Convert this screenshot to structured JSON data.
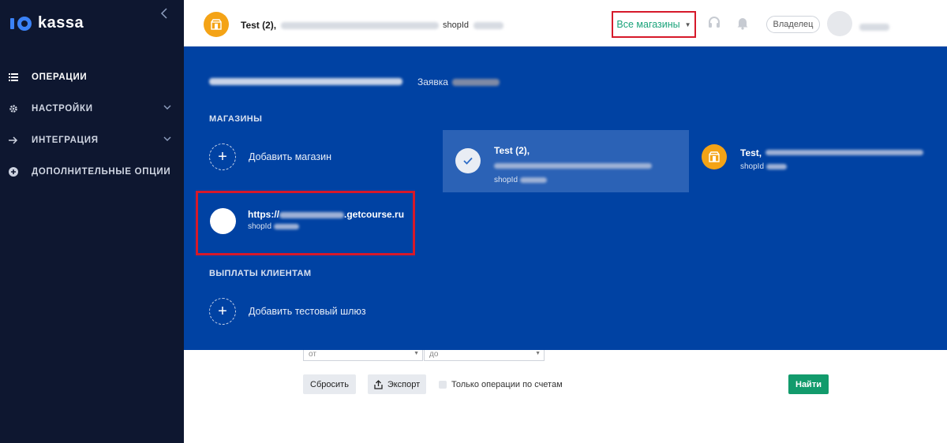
{
  "sidebar": {
    "logo_text": "kassa",
    "items": [
      {
        "label": "ОПЕРАЦИИ",
        "icon": "list-icon",
        "active": true,
        "has_chevron": false
      },
      {
        "label": "НАСТРОЙКИ",
        "icon": "gear-icon",
        "active": false,
        "has_chevron": true
      },
      {
        "label": "ИНТЕГРАЦИЯ",
        "icon": "arrow-right-icon",
        "active": false,
        "has_chevron": true
      },
      {
        "label": "ДОПОЛНИТЕЛЬНЫЕ ОПЦИИ",
        "icon": "plus-circle-icon",
        "active": false,
        "has_chevron": false
      }
    ]
  },
  "header": {
    "shop_name": "Test (2),",
    "shopid_label": "shopId",
    "all_shops_label": "Все магазины",
    "owner_label": "Владелец"
  },
  "panel": {
    "request_label": "Заявка",
    "shops_section": "МАГАЗИНЫ",
    "add_shop_label": "Добавить магазин",
    "stores": [
      {
        "title": "Test (2),",
        "shopid_label": "shopId",
        "selected": true
      },
      {
        "title": "Test,",
        "shopid_label": "shopId",
        "selected": false
      },
      {
        "title_prefix": "https://",
        "title_suffix": ".getcourse.ru",
        "shopid_label": "shopId",
        "highlighted": true
      }
    ],
    "payouts_section": "ВЫПЛАТЫ КЛИЕНТАМ",
    "add_gateway_label": "Добавить тестовый шлюз"
  },
  "filters": {
    "from_label": "от",
    "to_label": "до",
    "reset_label": "Сбросить",
    "export_label": "Экспорт",
    "invoice_only_label": "Только операции по счетам",
    "find_label": "Найти"
  },
  "colors": {
    "sidebar_bg": "#0e1730",
    "panel_bg": "#0042a3",
    "accent_green": "#129b6c",
    "highlight_red": "#d6192a",
    "shop_orange": "#f4a316"
  }
}
